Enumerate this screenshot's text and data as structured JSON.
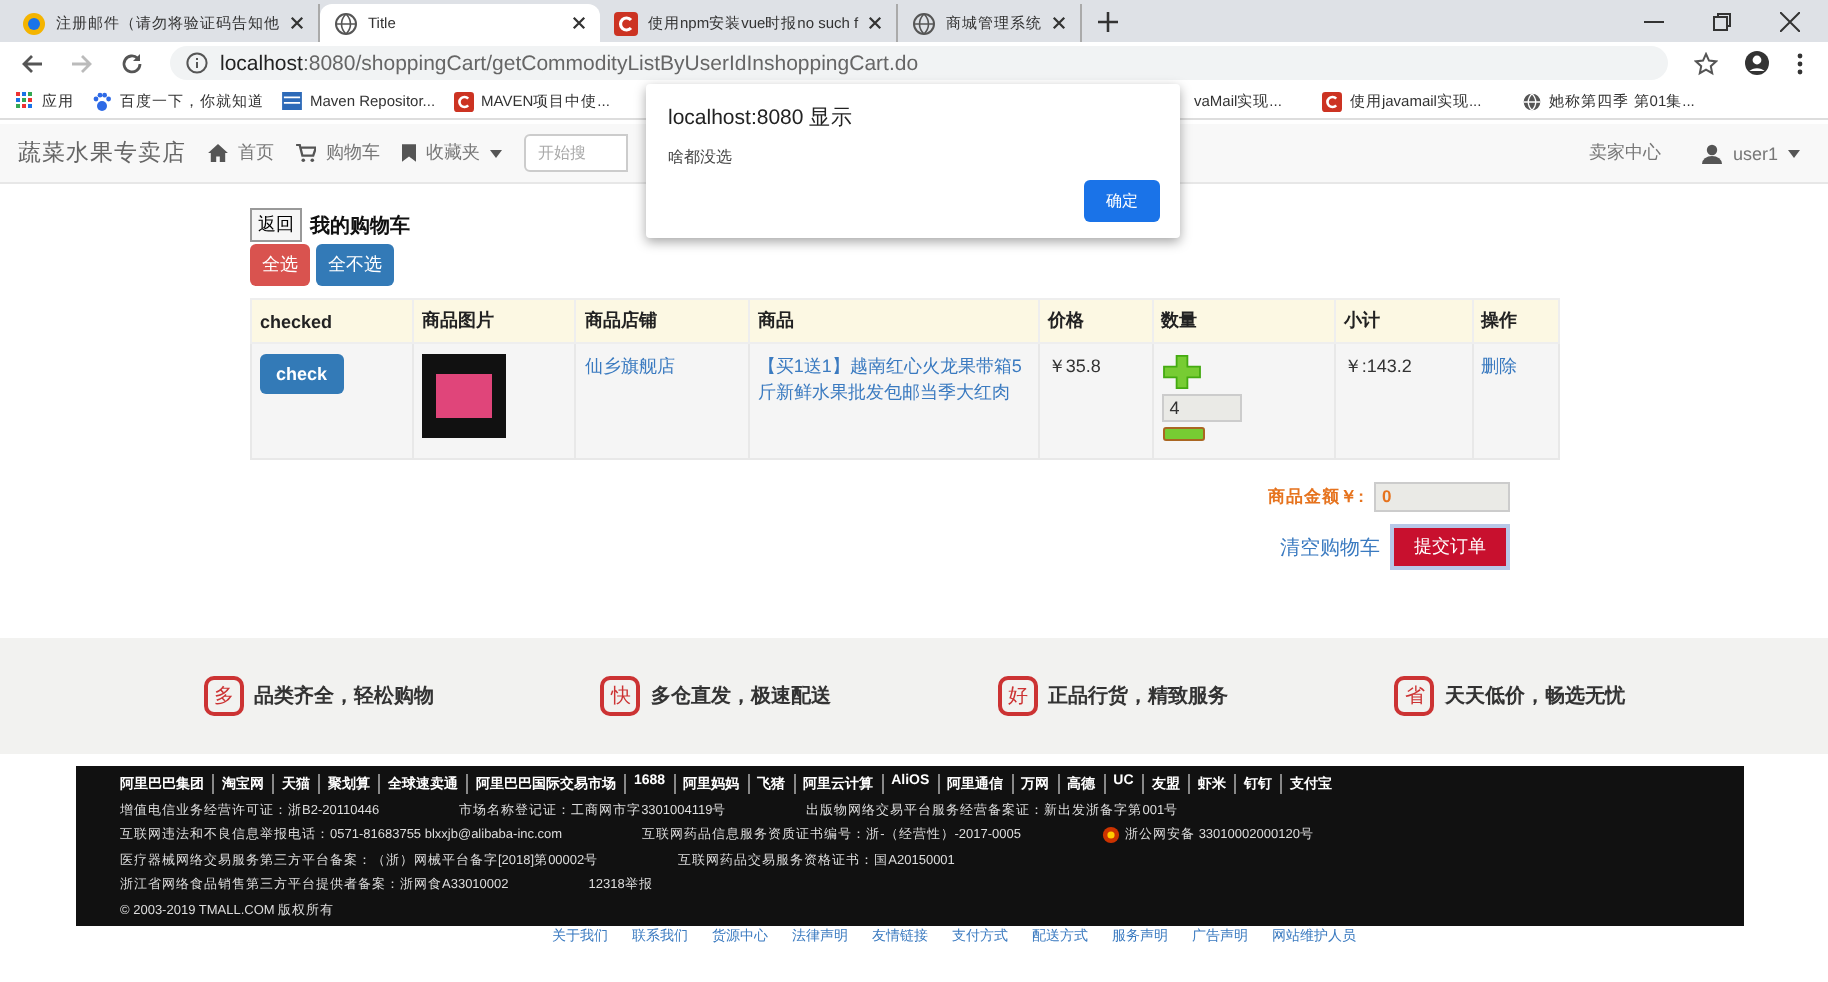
{
  "browser": {
    "tabs": [
      {
        "title": "注册邮件（请勿将验证码告知他",
        "selected": false
      },
      {
        "title": "Title",
        "selected": true
      },
      {
        "title": "使用npm安装vue时报no such f",
        "selected": false
      },
      {
        "title": "商城管理系统",
        "selected": false
      }
    ],
    "url_host": "localhost",
    "url_rest": ":8080/shoppingCart/getCommodityListByUserIdInshoppingCart.do",
    "bookmarks": [
      "应用",
      "百度一下，你就知道",
      "Maven Repositor...",
      "MAVEN项目中使...",
      "vaMail实现...",
      "使用javamail实现...",
      "她称第四季 第01集..."
    ]
  },
  "navbar": {
    "brand": "蔬菜水果专卖店",
    "links": [
      {
        "label": "首页"
      },
      {
        "label": "购物车"
      },
      {
        "label": "收藏夹",
        "dropdown": true
      }
    ],
    "search_placeholder": "开始搜",
    "right_link": "卖家中心",
    "user": "user1"
  },
  "dialog": {
    "title": "localhost:8080 显示",
    "message": "啥都没选",
    "button": "确定"
  },
  "cart": {
    "back": "返回",
    "title": "我的购物车",
    "select_all": "全选",
    "select_none": "全不选",
    "columns": [
      "checked",
      "商品图片",
      "商品店铺",
      "商品",
      "价格",
      "数量",
      "小计",
      "操作"
    ],
    "rows": [
      {
        "check": "check",
        "shop": "仙乡旗舰店",
        "product": "【买1送1】越南红心火龙果带箱5斤新鲜水果批发包邮当季大红肉",
        "price": "￥35.8",
        "quantity": "4",
        "subtotal": "￥:143.2",
        "action": "删除"
      }
    ],
    "total_label": "商品金额￥:",
    "total_value": "0",
    "clear": "清空购物车",
    "submit": "提交订单"
  },
  "features": [
    {
      "badge": "多",
      "text": "品类齐全，轻松购物"
    },
    {
      "badge": "快",
      "text": "多仓直发，极速配送"
    },
    {
      "badge": "好",
      "text": "正品行货，精致服务"
    },
    {
      "badge": "省",
      "text": "天天低价，畅选无忧"
    }
  ],
  "footer": {
    "links": [
      "阿里巴巴集团",
      "淘宝网",
      "天猫",
      "聚划算",
      "全球速卖通",
      "阿里巴巴国际交易市场",
      "1688",
      "阿里妈妈",
      "飞猪",
      "阿里云计算",
      "AliOS",
      "阿里通信",
      "万网",
      "高德",
      "UC",
      "友盟",
      "虾米",
      "钉钉",
      "支付宝"
    ],
    "rows": [
      [
        "增值电信业务经营许可证：浙B2-20110446",
        "市场名称登记证：工商网市字3301004119号",
        "出版物网络交易平台服务经营备案证：新出发浙备字第001号"
      ],
      [
        "互联网违法和不良信息举报电话：0571-81683755 blxxjb@alibaba-inc.com",
        "互联网药品信息服务资质证书编号：浙-（经营性）-2017-0005",
        "浙公网安备 33010002000120号"
      ],
      [
        "医疗器械网络交易服务第三方平台备案：（浙）网械平台备字[2018]第00002号",
        "互联网药品交易服务资格证书：国A20150001"
      ],
      [
        "浙江省网络食品销售第三方平台提供者备案：浙网食A33010002",
        "12318举报"
      ],
      [
        "© 2003-2019 TMALL.COM 版权所有"
      ]
    ],
    "bottom_links": [
      "关于我们",
      "联系我们",
      "货源中心",
      "法律声明",
      "友情链接",
      "支付方式",
      "配送方式",
      "服务声明",
      "广告声明",
      "网站维护人员"
    ]
  }
}
